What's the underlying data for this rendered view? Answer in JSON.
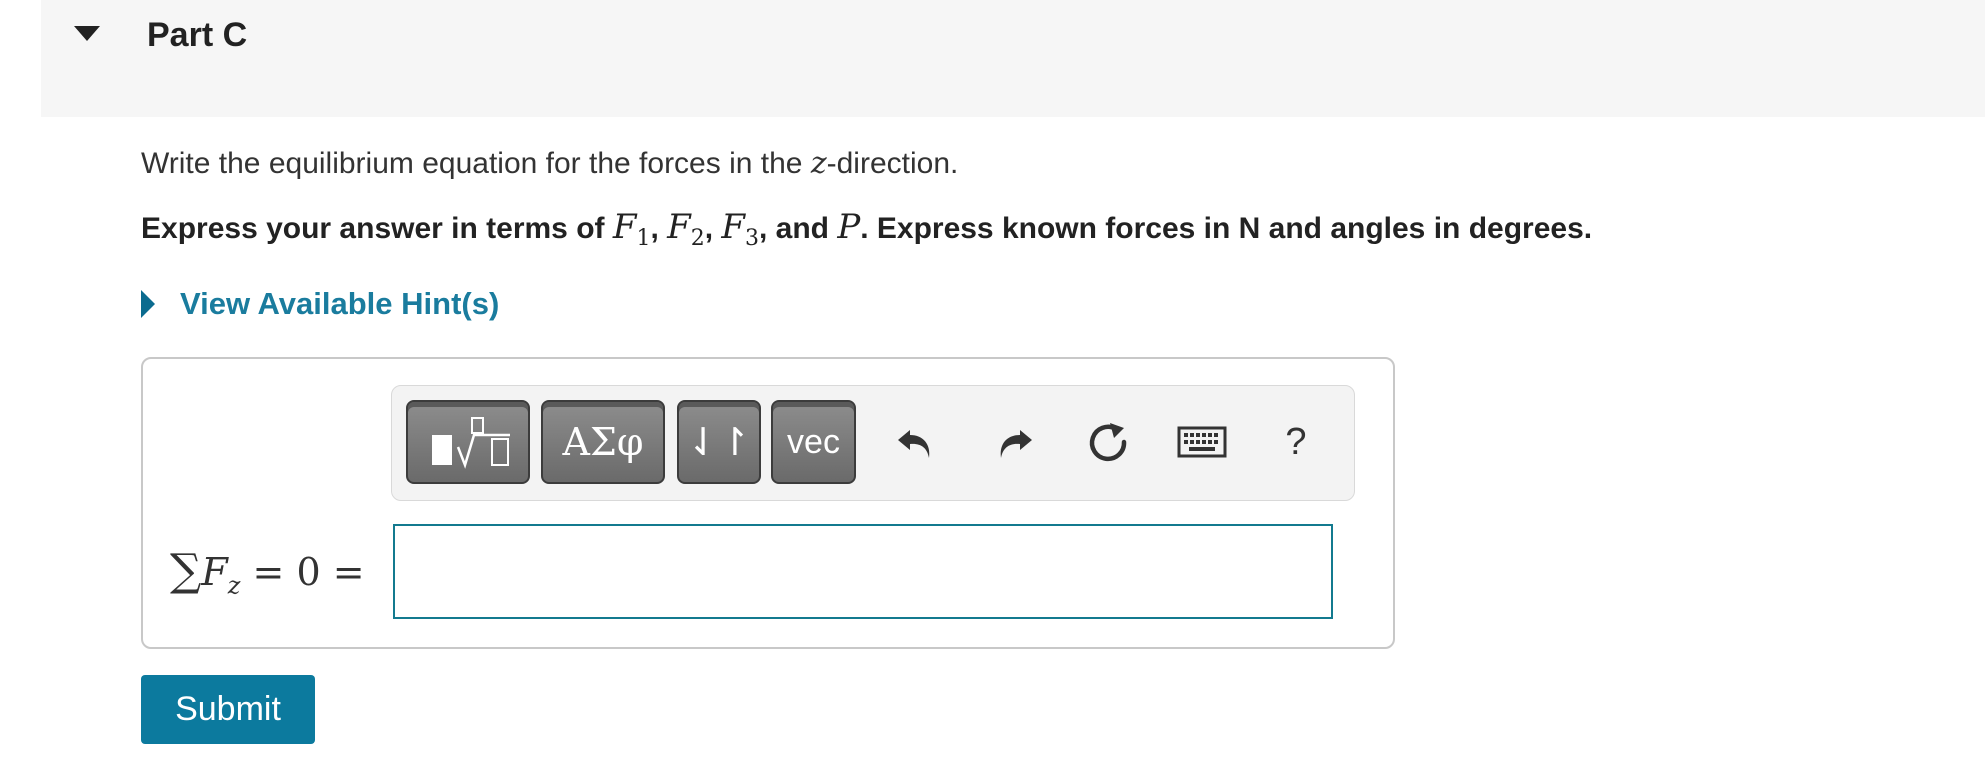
{
  "part": {
    "title": "Part C"
  },
  "question": {
    "text_before": "Write the equilibrium equation for the forces in the ",
    "var_z": "z",
    "text_after": "-direction."
  },
  "instructions": {
    "prefix": "Express your answer in terms of ",
    "f": "F",
    "sub1": "1",
    "sub2": "2",
    "sub3": "3",
    "comma": ", ",
    "and": ", and ",
    "p": "P",
    "suffix": ". Express known forces in N and angles in degrees."
  },
  "hint": {
    "label": "View Available Hint(s)"
  },
  "toolbar": {
    "greek_label": "ΑΣφ",
    "arrows_label": "⇃↾",
    "vec_label": "vec",
    "help_label": "?"
  },
  "equation": {
    "sigma": "∑",
    "f": "F",
    "sub_z": "z",
    "rest": " = 0 ="
  },
  "answer": {
    "value": "",
    "placeholder": ""
  },
  "submit": {
    "label": "Submit"
  },
  "colors": {
    "accent": "#0c7a9e",
    "link": "#1a7c9e",
    "header_bg": "#f6f6f6",
    "input_border": "#137a8f"
  }
}
